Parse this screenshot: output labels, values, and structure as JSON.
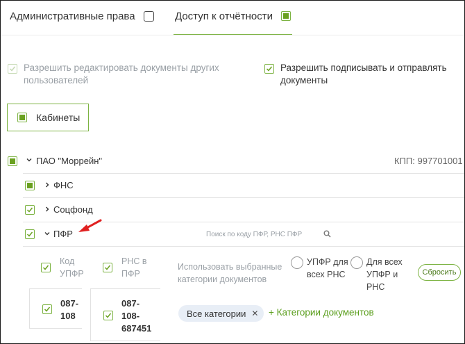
{
  "tabs": {
    "admin": {
      "label": "Административные права",
      "checked": false
    },
    "reports": {
      "label": "Доступ к отчётности",
      "checked": true
    }
  },
  "permissions": {
    "edit_docs": {
      "label": "Разрешить редактировать документы других пользователей",
      "checked": true,
      "disabled": true
    },
    "sign_send": {
      "label": "Разрешить подписывать и отправлять документы",
      "checked": true
    }
  },
  "cabinets": {
    "label": "Кабинеты",
    "checked": true
  },
  "org": {
    "name": "ПАО \"Моррейн\"",
    "kpp": "КПП: 997701001",
    "checked": true
  },
  "nodes": [
    {
      "label": "ФНС",
      "state": "filled",
      "expanded": false
    },
    {
      "label": "Соцфонд",
      "state": "check",
      "expanded": false
    },
    {
      "label": "ПФР",
      "state": "check",
      "expanded": true
    }
  ],
  "pfr": {
    "search_placeholder": "Поиск по коду ПФР, РНС ПФР",
    "col_code": "Код УПФР",
    "col_rns": "РНС в ПФР",
    "use_categories": "Использовать выбранные категории документов",
    "radio_all_rns": "УПФР для всех РНС",
    "radio_all_upfr": "Для всех УПФР и РНС",
    "reset_label": "Сбросить",
    "row": {
      "code": "087-108",
      "rns": "087-108-687451"
    },
    "chip": "Все категории",
    "add_categories": "+ Категории документов"
  },
  "colors": {
    "accent": "#6aa120",
    "arrow": "#e02020"
  }
}
